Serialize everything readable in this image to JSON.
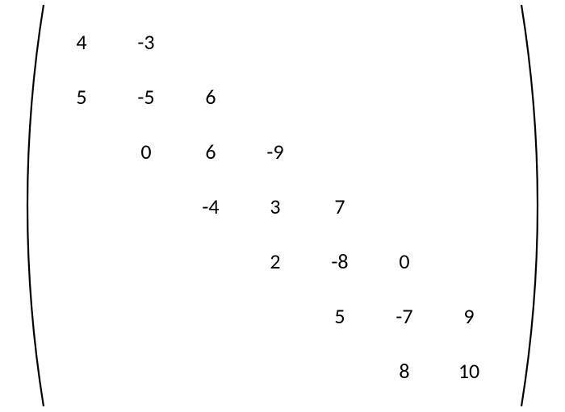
{
  "chart_data": {
    "type": "matrix",
    "description": "7×7 tridiagonal (band) matrix displayed inside large parentheses. Empty cells are blank (implicit zero).",
    "rows": 7,
    "cols": 7,
    "entries": [
      [
        "4",
        "-3",
        "",
        "",
        "",
        "",
        ""
      ],
      [
        "5",
        "-5",
        "6",
        "",
        "",
        "",
        ""
      ],
      [
        "",
        "0",
        "6",
        "-9",
        "",
        "",
        ""
      ],
      [
        "",
        "",
        "-4",
        "3",
        "7",
        "",
        ""
      ],
      [
        "",
        "",
        "",
        "2",
        "-8",
        "0",
        ""
      ],
      [
        "",
        "",
        "",
        "",
        "5",
        "-7",
        "9"
      ],
      [
        "",
        "",
        "",
        "",
        "",
        "8",
        "10"
      ]
    ]
  },
  "m": {
    "r0c0": "4",
    "r0c1": "-3",
    "r1c0": "5",
    "r1c1": "-5",
    "r1c2": "6",
    "r2c1": "0",
    "r2c2": "6",
    "r2c3": "-9",
    "r3c2": "-4",
    "r3c3": "3",
    "r3c4": "7",
    "r4c3": "2",
    "r4c4": "-8",
    "r4c5": "0",
    "r5c4": "5",
    "r5c5": "-7",
    "r5c6": "9",
    "r6c5": "8",
    "r6c6": "10"
  }
}
